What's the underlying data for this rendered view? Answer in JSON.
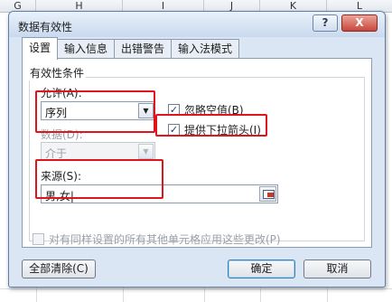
{
  "sheet": {
    "columns": [
      "G",
      "H",
      "I",
      "J",
      "K",
      "L"
    ]
  },
  "dialog": {
    "title": "数据有效性",
    "help_label": "?",
    "close_label": "X",
    "tabs": [
      {
        "label": "设置",
        "active": true
      },
      {
        "label": "输入信息",
        "active": false
      },
      {
        "label": "出错警告",
        "active": false
      },
      {
        "label": "输入法模式",
        "active": false
      }
    ],
    "criteria": {
      "group_label": "有效性条件",
      "allow_label": "允许(A):",
      "allow_value": "序列",
      "data_label": "数据(D):",
      "data_value": "介于",
      "ignore_blank_label": "忽略空值(B)",
      "ignore_blank_checked": true,
      "in_cell_dropdown_label": "提供下拉箭头(I)",
      "in_cell_dropdown_checked": true,
      "source_label": "来源(S):",
      "source_value": "男,女|"
    },
    "apply_all_label": "对有同样设置的所有其他单元格应用这些更改(P)",
    "apply_all_checked": false,
    "buttons": {
      "clear_all": "全部清除(C)",
      "ok": "确定",
      "cancel": "取消"
    }
  },
  "colors": {
    "highlight": "#e0141c",
    "dialog_bg": "#dbe6f4",
    "close_button": "#c9463a"
  }
}
